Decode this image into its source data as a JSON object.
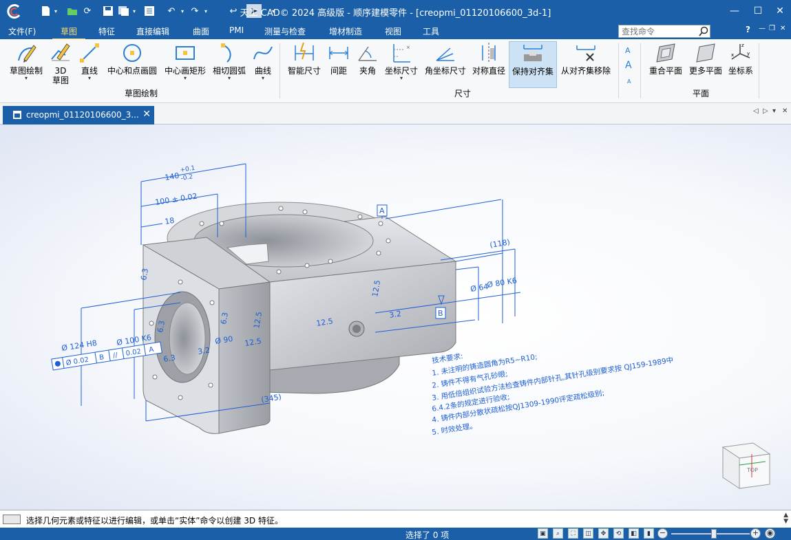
{
  "window": {
    "title": "天工 CAD© 2024 高级版 - 顺序建模零件 - [creopmi_01120106600_3d-1]"
  },
  "menu": {
    "items": [
      "文件(F)",
      "草图",
      "特征",
      "直接编辑",
      "曲面",
      "PMI",
      "测量与检查",
      "增材制造",
      "视图",
      "工具"
    ],
    "active": "草图",
    "search_placeholder": "查找命令",
    "help": "?"
  },
  "ribbon": {
    "buttons": [
      {
        "label": "草图绘制"
      },
      {
        "label": "3D\n草图"
      },
      {
        "label": "直线"
      },
      {
        "label": "中心和点画圆"
      },
      {
        "label": "中心画矩形"
      },
      {
        "label": "相切圆弧"
      },
      {
        "label": "曲线"
      },
      {
        "label": "智能尺寸"
      },
      {
        "label": "间距"
      },
      {
        "label": "夹角"
      },
      {
        "label": "坐标尺寸"
      },
      {
        "label": "角坐标尺寸"
      },
      {
        "label": "对称直径"
      },
      {
        "label": "保持对齐集"
      },
      {
        "label": "从对齐集移除"
      },
      {
        "label": "重合平面"
      },
      {
        "label": "更多平面"
      },
      {
        "label": "坐标系"
      }
    ],
    "groups": [
      "草图绘制",
      "尺寸",
      "平面"
    ]
  },
  "doc_tab": {
    "label": "creopmi_01120106600_3..."
  },
  "drawing": {
    "dims": [
      "140",
      "+0.1",
      "-0.2",
      "100 ± 0.02",
      "18",
      "(118)",
      "Ø 64",
      "Ø 80 K6",
      "12.5",
      "3.2",
      "Ø 124 H8",
      "Ø 100 K6",
      "Ø 90",
      "Ø 0.02",
      "0.02",
      "(345)",
      "6.3"
    ],
    "datums": [
      "A",
      "B"
    ],
    "tech_title": "技术要求:",
    "tech_lines": [
      "1. 未注明的铸造圆角为R5~R10;",
      "2. 铸件不得有气孔砂眼;",
      "3. 用低倍组织试验方法检查铸件内部针孔,其针孔级别要求按  QJ159-1989中",
      "6.4.2条的规定进行验收;",
      "4. 铸件内部分散状疏松按QJ1309-1990评定疏松级别;",
      "5. 时效处理。"
    ],
    "viewcube_face": "TOP"
  },
  "command_line": {
    "text": "选择几何元素或特征以进行编辑，或单击“实体”命令以创建 3D 特征。"
  },
  "status": {
    "text": "选择了 0 项"
  }
}
